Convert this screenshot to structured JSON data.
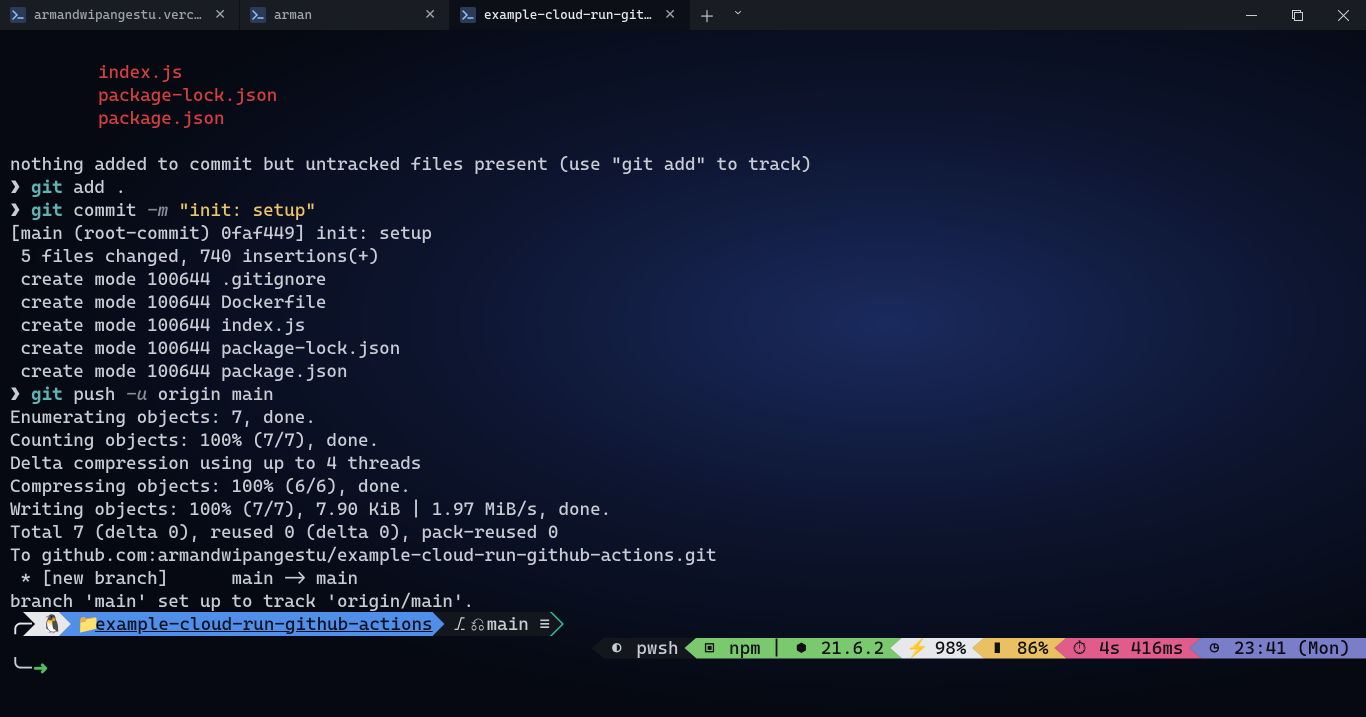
{
  "titlebar": {
    "tabs": [
      {
        "label": "armandwipangestu.vercel.app",
        "active": false
      },
      {
        "label": "arman",
        "active": false
      },
      {
        "label": "example-cloud-run-github-ac",
        "active": true
      }
    ]
  },
  "terminal": {
    "untracked": [
      "index.js",
      "package-lock.json",
      "package.json"
    ],
    "nothing_line": "nothing added to commit but untracked files present (use \"git add\" to track)",
    "cmd_add": {
      "git": "git",
      "rest": " add ."
    },
    "cmd_commit": {
      "git": "git",
      "rest": " commit ",
      "flag": "-m",
      "string": " \"init: setup\""
    },
    "commit_out": [
      "[main (root-commit) 0faf449] init: setup",
      " 5 files changed, 740 insertions(+)",
      " create mode 100644 .gitignore",
      " create mode 100644 Dockerfile",
      " create mode 100644 index.js",
      " create mode 100644 package-lock.json",
      " create mode 100644 package.json"
    ],
    "cmd_push": {
      "git": "git",
      "rest1": " push ",
      "flag": "-u",
      "rest2": " origin main"
    },
    "push_out": [
      "Enumerating objects: 7, done.",
      "Counting objects: 100% (7/7), done.",
      "Delta compression using up to 4 threads",
      "Compressing objects: 100% (6/6), done.",
      "Writing objects: 100% (7/7), 7.90 KiB | 1.97 MiB/s, done.",
      "Total 7 (delta 0), reused 0 (delta 0), pack-reused 0",
      "To github.com:armandwipangestu/example-cloud-run-github-actions.git",
      " * [new branch]      main -> main",
      "branch 'main' set up to track 'origin/main'."
    ]
  },
  "prompt1": {
    "folder": "example-cloud-run-github-actions",
    "branch": " main ≡"
  },
  "prompt2": {
    "shell": "pwsh",
    "npm": " npm | ",
    "node_ver": " 21.6.2",
    "battery": " 98%",
    "battery2": " 86%",
    "timing": " 4s 416ms",
    "clock": " 23:41 (Mon)"
  }
}
